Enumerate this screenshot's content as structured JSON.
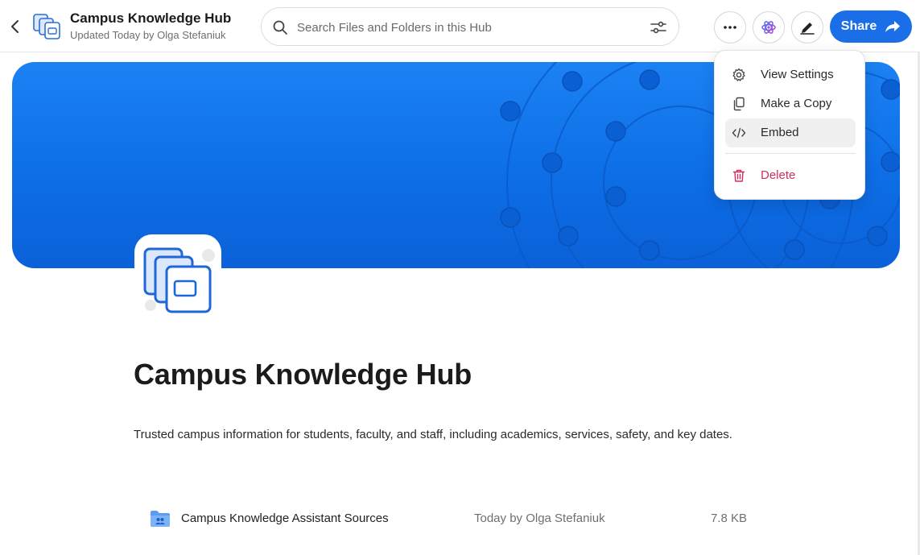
{
  "header": {
    "title": "Campus Knowledge Hub",
    "subtitle": "Updated Today by Olga Stefaniuk",
    "back_icon": "chevron-left-icon",
    "logo_icon": "hub-stack-icon"
  },
  "search": {
    "placeholder": "Search Files and Folders in this Hub",
    "value": "",
    "icon": "search-icon",
    "filter_icon": "filter-sliders-icon"
  },
  "toolbar": {
    "more_icon": "more-horizontal-icon",
    "ai_icon": "ai-atom-icon",
    "edit_icon": "edit-pen-icon",
    "share_label": "Share",
    "share_icon": "share-arrow-icon",
    "accent_color": "#1a6fe8"
  },
  "menu": {
    "items": [
      {
        "label": "View Settings",
        "icon": "gear-icon"
      },
      {
        "label": "Make a Copy",
        "icon": "copy-icon"
      },
      {
        "label": "Embed",
        "icon": "code-icon"
      },
      {
        "label": "Delete",
        "icon": "trash-icon",
        "color": "#d0305a"
      }
    ]
  },
  "banner": {
    "color": "#1378ee"
  },
  "main": {
    "title": "Campus Knowledge Hub",
    "description": "Trusted campus information for students, faculty, and staff, including academics, services, safety, and key dates.",
    "files": [
      {
        "name": "Campus Knowledge Assistant Sources",
        "modified": "Today by Olga Stefaniuk",
        "size": "7.8 KB",
        "icon": "shared-folder-icon"
      }
    ]
  }
}
